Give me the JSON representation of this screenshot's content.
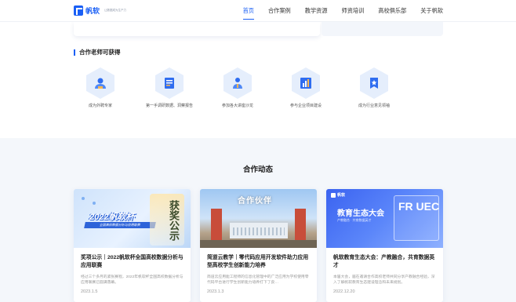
{
  "header": {
    "logo_text": "帆软",
    "logo_sub": "让数据成为生产力",
    "nav": [
      "首页",
      "合作案例",
      "教学资源",
      "师资培训",
      "高校俱乐部",
      "关于帆软"
    ],
    "active_nav": "首页"
  },
  "benefits": {
    "title": "合作老师可获得",
    "items": [
      {
        "label": "成为外聘专家",
        "icon": "user-expert-icon"
      },
      {
        "label": "第一手调研数据、洞察报告",
        "icon": "report-icon"
      },
      {
        "label": "参加各大讲座沙龙",
        "icon": "speaker-icon"
      },
      {
        "label": "参与企业项目建设",
        "icon": "bar-chart-icon"
      },
      {
        "label": "成为行业意见领袖",
        "icon": "leader-icon"
      }
    ]
  },
  "news": {
    "title": "合作动态",
    "cards": [
      {
        "title": "奖项公示｜2022帆软杯全国高校数据分析与应用联赛",
        "desc": "经过三个多月的紧张赛程，2022年帆软杯全国高校数据分析与应用联赛已圆满落幕。",
        "date": "2023.1.5",
        "image_text_main": "2022帆软杯",
        "image_text_sub": "全国高校数据分析与应用联赛",
        "image_text_side": "获奖公示"
      },
      {
        "title": "简道云教学｜零代码应用开发软件助力应用型高校学生创新能力培养",
        "desc": "简道云应用能工程师的信息化管理中的广泛应用为学校使用零代码平台进行学生创新能力培养打下了良…",
        "date": "2023.1.3",
        "image_text_main": "合作伙伴"
      },
      {
        "title": "帆软教育生态大会：产教融合，共育数据英才",
        "desc": "本届大会，届在邀请合作高校老师共同分享产教融合经验，深入了解帆软教育生态建设理念和未来规划。",
        "date": "2022.12.20",
        "image_text_logo": "帆软",
        "image_text_main": "教育生态大会",
        "image_text_sub": "产教融合 · 共育数据英才",
        "image_text_side": "FR UEC"
      }
    ]
  }
}
